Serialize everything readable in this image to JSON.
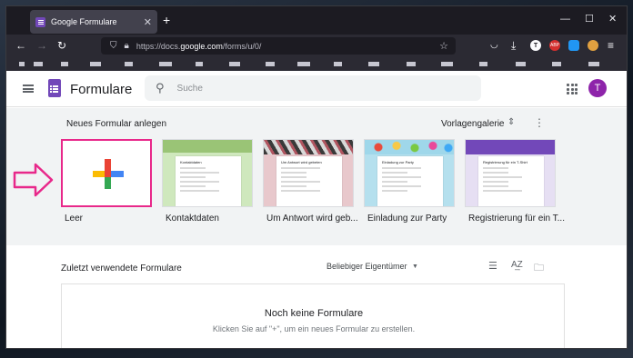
{
  "browser": {
    "tab_title": "Google Formulare",
    "tab_close": "✕",
    "new_tab": "+",
    "url_prefix": "https://docs.",
    "url_domain": "google.com",
    "url_path": "/forms/u/0/",
    "window_controls": [
      "—",
      "☐",
      "✕"
    ],
    "ext_letter": "T",
    "ext_badge": "ABP",
    "menu_glyph": "≡"
  },
  "app": {
    "title": "Formulare",
    "search_placeholder": "Suche",
    "avatar_letter": "T"
  },
  "templates": {
    "heading": "Neues Formular anlegen",
    "gallery_label": "Vorlagengalerie",
    "cards": [
      {
        "label": "Leer"
      },
      {
        "label": "Kontaktdaten",
        "title": "Kontaktdaten",
        "color": "#9ac476"
      },
      {
        "label": "Um Antwort wird geb...",
        "title": "Um Antwort wird gebeten",
        "color": "#c97f87"
      },
      {
        "label": "Einladung zur Party",
        "title": "Einladung zur Party",
        "color": "#4fb3cf"
      },
      {
        "label": "Registrierung für ein T...",
        "title": "Registrierung für ein T-Shirt",
        "color": "#7248b9"
      }
    ]
  },
  "recent": {
    "heading": "Zuletzt verwendete Formulare",
    "owner_filter": "Beliebiger Eigentümer",
    "empty_title": "Noch keine Formulare",
    "empty_subtitle": "Klicken Sie auf \"+\", um ein neues Formular zu erstellen."
  },
  "annotation": {
    "arrow_color": "#e8288a",
    "highlight_color": "#e8288a"
  }
}
